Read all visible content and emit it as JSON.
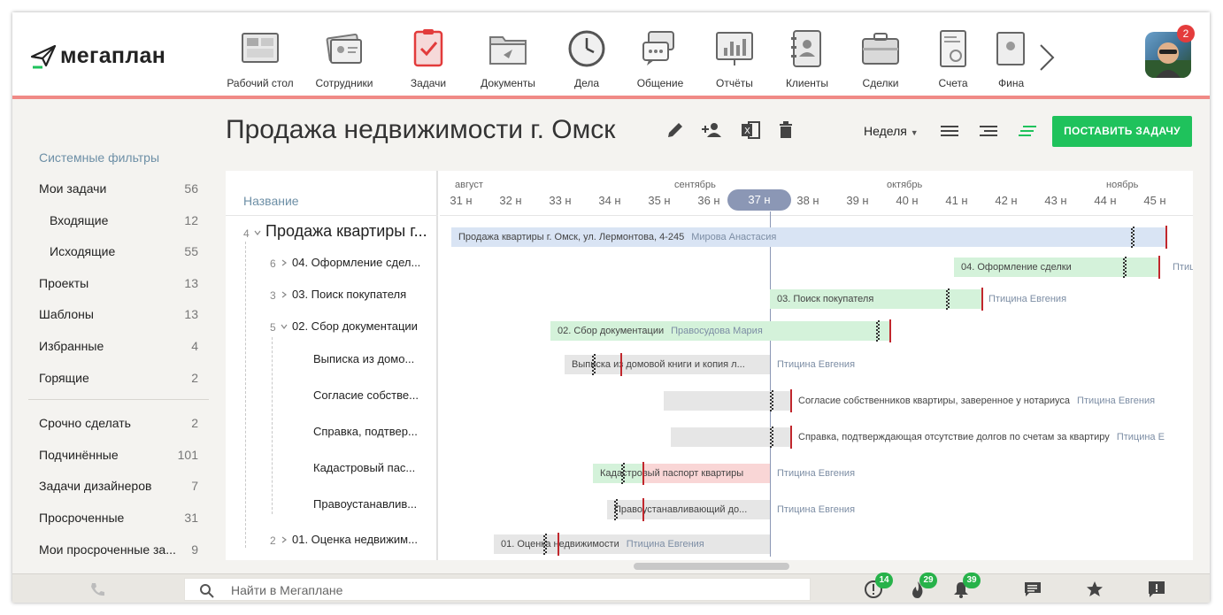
{
  "app": {
    "logo": "мегаплан"
  },
  "nav": {
    "items": [
      {
        "label": "Рабочий стол",
        "icon": "desktop-icon"
      },
      {
        "label": "Сотрудники",
        "icon": "employees-icon"
      },
      {
        "label": "Задачи",
        "icon": "tasks-icon"
      },
      {
        "label": "Документы",
        "icon": "documents-icon"
      },
      {
        "label": "Дела",
        "icon": "clock-icon"
      },
      {
        "label": "Общение",
        "icon": "chat-icon"
      },
      {
        "label": "Отчёты",
        "icon": "reports-icon"
      },
      {
        "label": "Клиенты",
        "icon": "clients-icon"
      },
      {
        "label": "Сделки",
        "icon": "deals-icon"
      },
      {
        "label": "Счета",
        "icon": "invoices-icon"
      },
      {
        "label": "Фина",
        "icon": "finance-icon"
      }
    ],
    "avatar_badge": "2"
  },
  "sidebar": {
    "title": "Системные фильтры",
    "items": [
      {
        "label": "Мои задачи",
        "count": "56"
      },
      {
        "label": "Входящие",
        "count": "12"
      },
      {
        "label": "Исходящие",
        "count": "55"
      },
      {
        "label": "Проекты",
        "count": "13"
      },
      {
        "label": "Шаблоны",
        "count": "13"
      },
      {
        "label": "Избранные",
        "count": "4"
      },
      {
        "label": "Горящие",
        "count": "2"
      },
      {
        "label": "Срочно сделать",
        "count": "2"
      },
      {
        "label": "Подчинённые",
        "count": "101"
      },
      {
        "label": "Задачи дизайнеров",
        "count": "7"
      },
      {
        "label": "Просроченные",
        "count": "31"
      },
      {
        "label": "Мои просроченные за...",
        "count": "9"
      }
    ]
  },
  "page": {
    "title": "Продажа недвижимости г. Омск",
    "period": "Неделя",
    "add_button": "ПОСТАВИТЬ ЗАДАЧУ"
  },
  "gantt": {
    "name_header": "Название",
    "months": [
      "август",
      "сентябрь",
      "октябрь",
      "ноябрь"
    ],
    "weeks": [
      "31 н",
      "32 н",
      "33 н",
      "34 н",
      "35 н",
      "36 н",
      "37 н",
      "38 н",
      "39 н",
      "40 н",
      "41 н",
      "42 н",
      "43 н",
      "44 н",
      "45 н"
    ],
    "current_week": "37 н",
    "rows": [
      {
        "count": "4",
        "name": "Продажа квартиры г...",
        "bar_text": "Продажа квартиры г. Омск, ул. Лермонтова, 4-245",
        "assignee": "Мирова Анастасия"
      },
      {
        "count": "6",
        "name": "04. Оформление сдел...",
        "bar_text": "04. Оформление сделки",
        "assignee": "Птиц"
      },
      {
        "count": "3",
        "name": "03. Поиск покупателя",
        "bar_text": "03. Поиск покупателя",
        "assignee": "Птицина Евгения"
      },
      {
        "count": "5",
        "name": "02. Сбор документации",
        "bar_text": "02. Сбор документации",
        "assignee": "Правосудова Мария"
      },
      {
        "count": "",
        "name": "Выписка из домо...",
        "bar_text": "Выписка из домовой книги и копия л...",
        "assignee": "Птицина Евгения"
      },
      {
        "count": "",
        "name": "Согласие собстве...",
        "bar_text": "Согласие собственников квартиры, заверенное у нотариуса",
        "assignee": "Птицина Евгения"
      },
      {
        "count": "",
        "name": "Справка, подтвер...",
        "bar_text": "Справка, подтверждающая отсутствие долгов по счетам за квартиру",
        "assignee": "Птицина Е"
      },
      {
        "count": "",
        "name": "Кадастровый пас...",
        "bar_text": "Кадастровый паспорт квартиры",
        "assignee": "Птицина Евгения"
      },
      {
        "count": "",
        "name": "Правоустанавлив...",
        "bar_text": "Правоустанавливающий до...",
        "assignee": "Птицина Евгения"
      },
      {
        "count": "2",
        "name": "01. Оценка недвижим...",
        "bar_text": "01. Оценка недвижимости",
        "assignee": "Птицина Евгения"
      }
    ]
  },
  "bottom": {
    "search_placeholder": "Найти в Мегаплане",
    "badges": {
      "alerts": "14",
      "hot": "29",
      "notifications": "39"
    }
  }
}
